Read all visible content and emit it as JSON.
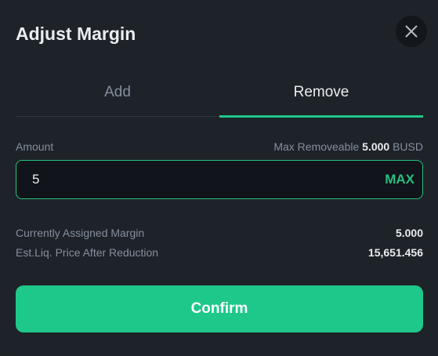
{
  "dialog": {
    "title": "Adjust Margin"
  },
  "tabs": [
    {
      "label": "Add",
      "active": false
    },
    {
      "label": "Remove",
      "active": true
    }
  ],
  "amount": {
    "label": "Amount",
    "max_removeable_label": "Max Removeable",
    "max_removeable_value": "5.000",
    "max_removeable_unit": "BUSD",
    "input_value": "5",
    "max_button_label": "MAX"
  },
  "info": {
    "assigned_margin_label": "Currently Assigned Margin",
    "assigned_margin_value": "5.000",
    "liq_price_label": "Est.Liq. Price After Reduction",
    "liq_price_value": "15,651.456"
  },
  "confirm_button_label": "Confirm",
  "colors": {
    "accent": "#1ec88a",
    "background": "#1e2329",
    "input_background": "#11141a",
    "muted_text": "#848e9c",
    "primary_text": "#eaecef"
  },
  "icons": {
    "close": "close-icon"
  }
}
